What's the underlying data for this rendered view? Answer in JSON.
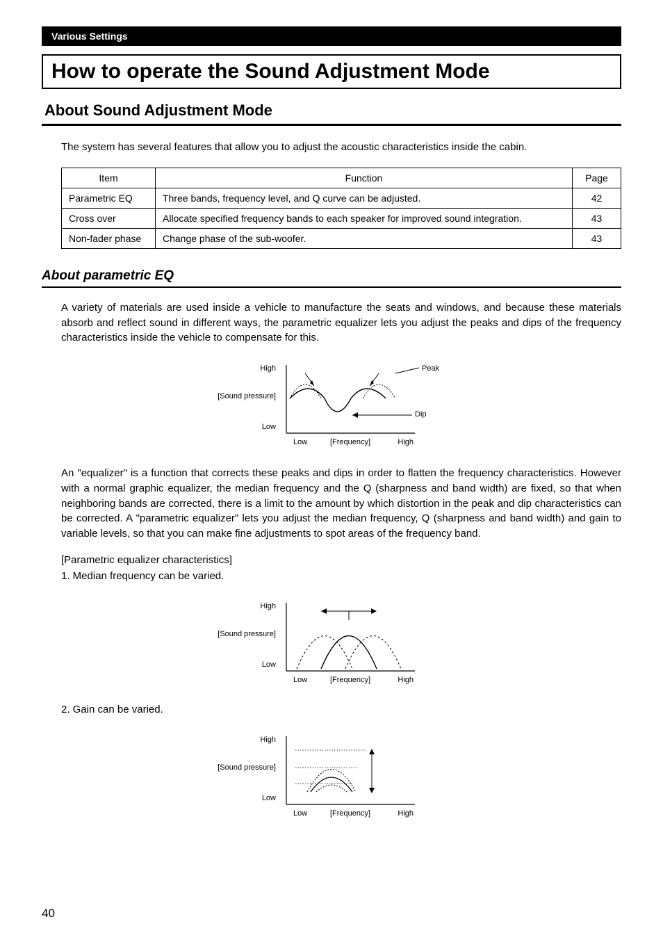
{
  "section_header": "Various Settings",
  "main_title": "How to operate the Sound Adjustment Mode",
  "sub_title": "About Sound Adjustment Mode",
  "intro_text": "The system has several features that allow you to adjust the acoustic characteristics inside the cabin.",
  "table_headers": {
    "item": "Item",
    "function": "Function",
    "page": "Page"
  },
  "table_rows": [
    {
      "item": "Parametric EQ",
      "function": "Three bands, frequency level, and Q curve can be adjusted.",
      "page": "42"
    },
    {
      "item": "Cross over",
      "function": "Allocate specified frequency bands to each speaker for improved sound integration.",
      "page": "43"
    },
    {
      "item": "Non-fader phase",
      "function": "Change phase of the sub-woofer.",
      "page": "43"
    }
  ],
  "peq_title": "About parametric EQ",
  "peq_para1": "A variety of materials are used inside a vehicle to manufacture the seats and windows, and because these materials absorb and reflect sound in different ways, the parametric equalizer lets you adjust the peaks and dips of the frequency characteristics inside the vehicle to compensate for this.",
  "diagram_labels": {
    "sound_pressure": "[Sound pressure]",
    "high": "High",
    "low": "Low",
    "frequency": "[Frequency]",
    "peak": "Peak",
    "dip": "Dip"
  },
  "peq_para2": "An \"equalizer\" is a function that corrects these peaks and dips in order to flatten the frequency characteristics. However with a normal graphic equalizer, the median frequency and the Q (sharpness and band width) are fixed, so that when neighboring bands are corrected, there is a limit to the amount by which distortion in the peak and dip characteristics can be corrected. A \"parametric equalizer\" lets you adjust the median frequency, Q (sharpness and band width) and gain to variable levels, so that you can make fine adjustments to spot areas of the frequency band.",
  "char_heading": "[Parametric equalizer characteristics]",
  "char_items": [
    "1. Median frequency can be varied.",
    "2. Gain can be varied."
  ],
  "page_number": "40"
}
